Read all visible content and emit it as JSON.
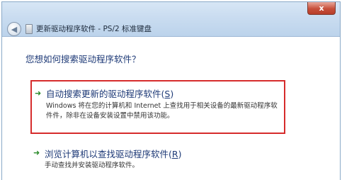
{
  "window": {
    "close_label": "x",
    "back_icon": "back-arrow",
    "title": "更新驱动程序软件 - PS/2 标准键盘"
  },
  "content": {
    "question": "您想如何搜索驱动程序软件？",
    "options": [
      {
        "title_main": "自动搜索更新的驱动程序软件(",
        "title_key": "S",
        "title_end": ")",
        "description": "Windows 将在您的计算机和 Internet 上查找用于相关设备的最新驱动程序软件件，除非在设备安装设置中禁用该功能。",
        "icon": "green-arrow"
      },
      {
        "title_main": "浏览计算机以查找驱动程序软件(",
        "title_key": "R",
        "title_end": ")",
        "description": "手动查找并安装驱动程序软件。",
        "icon": "green-arrow"
      }
    ]
  },
  "colors": {
    "link_blue": "#1e3a77",
    "highlight_red": "#d62c2c",
    "arrow_green": "#2a8a2a"
  }
}
